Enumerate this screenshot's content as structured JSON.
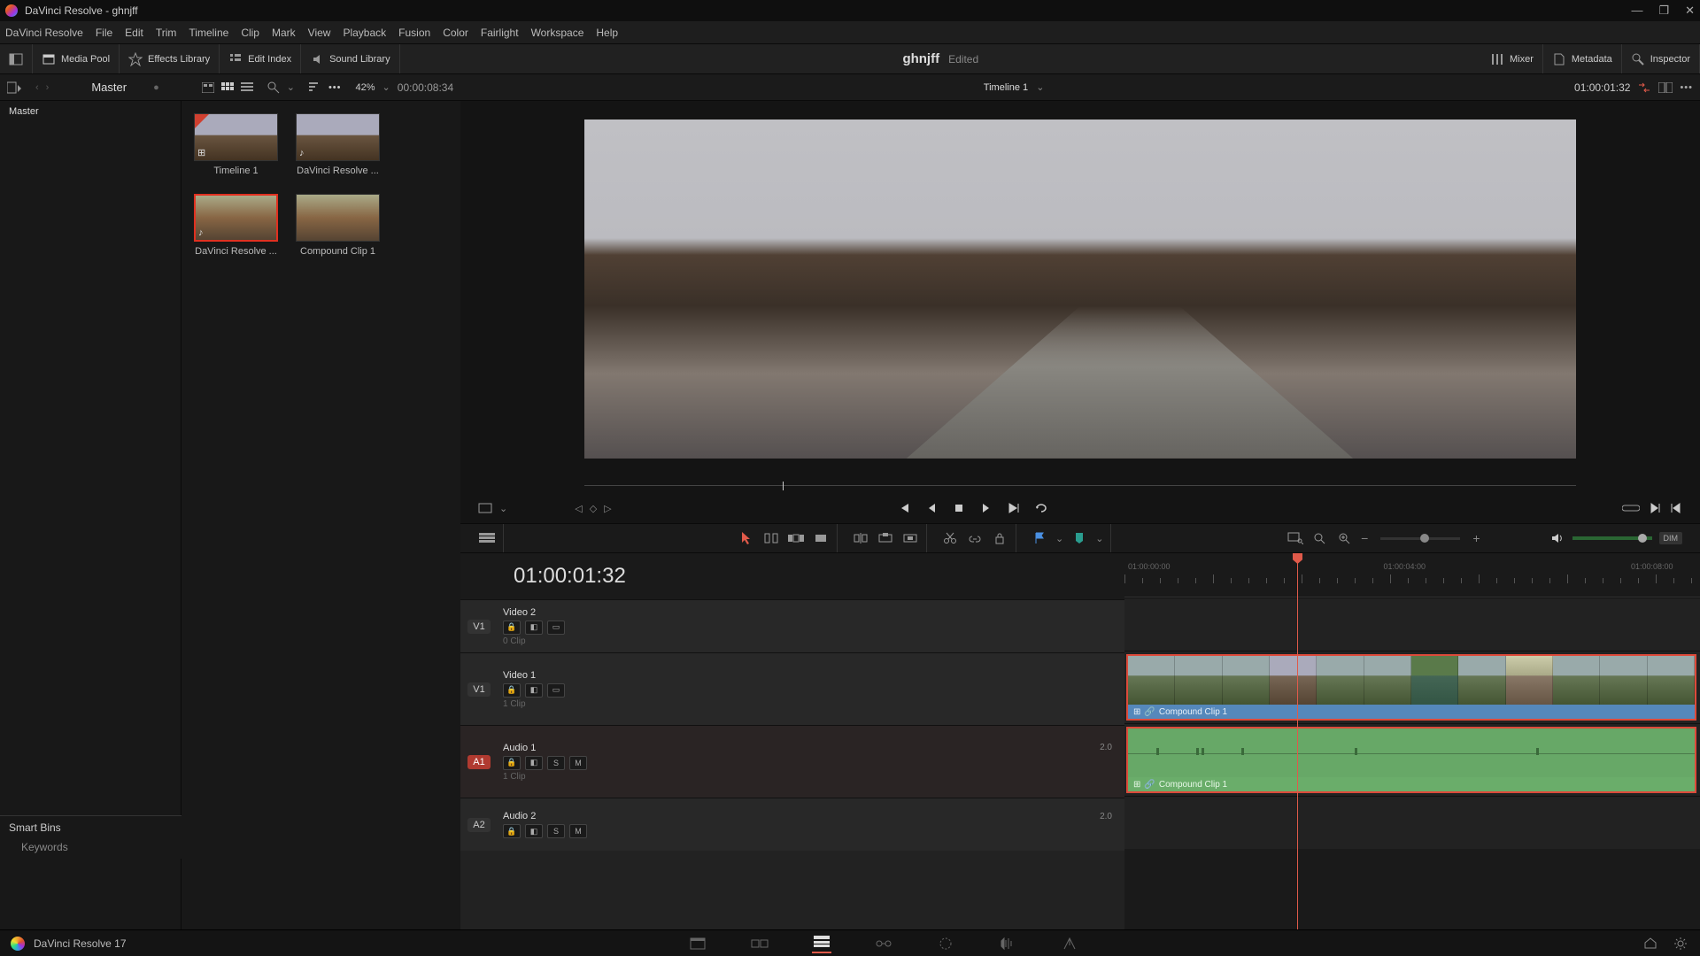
{
  "titlebar": {
    "title": "DaVinci Resolve - ghnjff"
  },
  "menu": [
    "DaVinci Resolve",
    "File",
    "Edit",
    "Trim",
    "Timeline",
    "Clip",
    "Mark",
    "View",
    "Playback",
    "Fusion",
    "Color",
    "Fairlight",
    "Workspace",
    "Help"
  ],
  "toptools": {
    "media_pool": "Media Pool",
    "effects_library": "Effects Library",
    "edit_index": "Edit Index",
    "sound_library": "Sound Library",
    "mixer": "Mixer",
    "metadata": "Metadata",
    "inspector": "Inspector"
  },
  "project": {
    "name": "ghnjff",
    "status": "Edited"
  },
  "subbar": {
    "master": "Master",
    "zoom_pct": "42%",
    "source_tc": "00:00:08:34",
    "timeline_name": "Timeline 1",
    "timeline_tc": "01:00:01:32"
  },
  "bins": {
    "root": "Master",
    "smart_title": "Smart Bins",
    "keywords": "Keywords"
  },
  "clips": [
    {
      "label": "Timeline 1",
      "kind": "timeline"
    },
    {
      "label": "DaVinci Resolve ...",
      "kind": "audio"
    },
    {
      "label": "DaVinci Resolve ...",
      "kind": "audio",
      "selected": true
    },
    {
      "label": "Compound Clip 1",
      "kind": "compound"
    }
  ],
  "timeline": {
    "tc": "01:00:01:32",
    "tracks": {
      "v2": {
        "tag": "V1",
        "name": "Video 2",
        "clips": "0 Clip"
      },
      "v1": {
        "tag": "V1",
        "name": "Video 1",
        "clips": "1 Clip"
      },
      "a1": {
        "tag": "A1",
        "name": "Audio 1",
        "ch": "2.0",
        "clips": "1 Clip"
      },
      "a2": {
        "tag": "A2",
        "name": "Audio 2",
        "ch": "2.0"
      }
    },
    "clip_name": "Compound Clip 1",
    "ruler": [
      "01:00:00:00",
      "01:00:04:00",
      "01:00:08:00"
    ],
    "controls": {
      "s": "S",
      "m": "M"
    }
  },
  "bottombar": {
    "version": "DaVinci Resolve 17"
  },
  "dim": "DIM"
}
